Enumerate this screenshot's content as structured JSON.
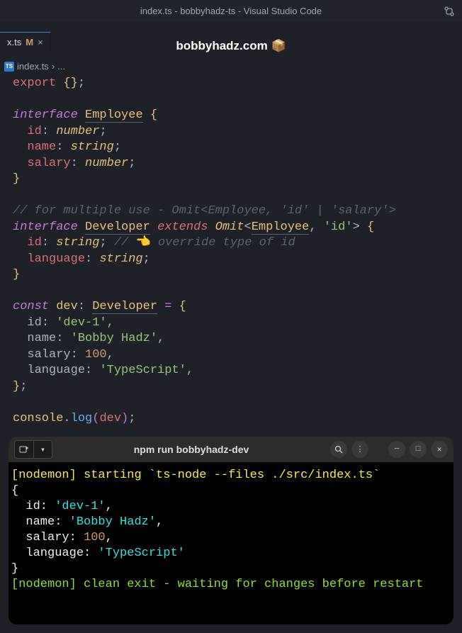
{
  "titlebar": "index.ts - bobbyhadz-ts - Visual Studio Code",
  "siteheader": "bobbyhadz.com",
  "tab": {
    "name": "x.ts",
    "modified": "M",
    "close": "×"
  },
  "breadcrumb": {
    "file": "index.ts",
    "sep": "›",
    "rest": "..."
  },
  "code": {
    "export": "export",
    "interface": "interface",
    "extends": "extends",
    "const": "const",
    "Employee": "Employee",
    "Developer": "Developer",
    "Omit": "Omit",
    "id": "id",
    "name": "name",
    "salary": "salary",
    "language": "language",
    "number": "number",
    "string": "string",
    "dev": "dev",
    "console": "console",
    "log": "log",
    "val_id": "'dev-1'",
    "val_name": "'Bobby Hadz'",
    "val_salary": "100",
    "val_lang": "'TypeScript'",
    "id_lit": "'id'",
    "comment1": "// for multiple use - Omit<Employee, 'id' | 'salary'>",
    "comment2_pre": "//",
    "comment2_emoji": "👈",
    "comment2_post": " override type of id"
  },
  "terminal": {
    "title": "npm run bobbyhadz-dev",
    "line1_prefix": "[nodemon]",
    "line1_rest": " starting `ts-node --files ./src/index.ts`",
    "out_open": "{",
    "out_id_k": "  id:",
    "out_id_v": " 'dev-1'",
    "out_name_k": "  name:",
    "out_name_v": " 'Bobby Hadz'",
    "out_salary_k": "  salary:",
    "out_salary_v": " 100",
    "out_lang_k": "  language:",
    "out_lang_v": " 'TypeScript'",
    "out_close": "}",
    "line_last": "[nodemon] clean exit - waiting for changes before restart",
    "comma": ","
  }
}
